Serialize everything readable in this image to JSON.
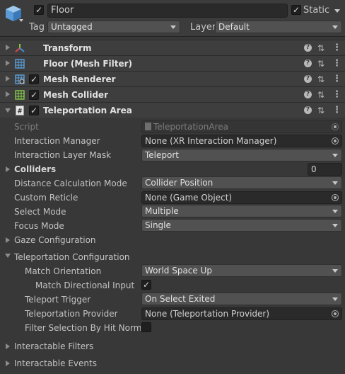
{
  "header": {
    "object_name": "Floor",
    "static_label": "Static",
    "tag_label": "Tag",
    "tag_value": "Untagged",
    "layer_label": "Layer",
    "layer_value": "Default",
    "active_checked": true,
    "static_checked": true
  },
  "components": [
    {
      "name": "Transform",
      "icon": "transform-icon",
      "has_checkbox": false
    },
    {
      "name": "Floor (Mesh Filter)",
      "icon": "mesh-filter-icon",
      "has_checkbox": false
    },
    {
      "name": "Mesh Renderer",
      "icon": "mesh-renderer-icon",
      "has_checkbox": true
    },
    {
      "name": "Mesh Collider",
      "icon": "mesh-collider-icon",
      "has_checkbox": true
    },
    {
      "name": "Teleportation Area",
      "icon": "script-icon",
      "has_checkbox": true
    }
  ],
  "help_glyph": "?",
  "presets_glyph": "⇅",
  "more_glyph": "⋮",
  "check_glyph": "✓",
  "properties": {
    "script_label": "Script",
    "script_value": "TeleportationArea",
    "interaction_manager_label": "Interaction Manager",
    "interaction_manager_value": "None (XR Interaction Manager)",
    "interaction_layer_mask_label": "Interaction Layer Mask",
    "interaction_layer_mask_value": "Teleport",
    "colliders_label": "Colliders",
    "colliders_value": "0",
    "distance_calc_label": "Distance Calculation Mode",
    "distance_calc_value": "Collider Position",
    "custom_reticle_label": "Custom Reticle",
    "custom_reticle_value": "None (Game Object)",
    "select_mode_label": "Select Mode",
    "select_mode_value": "Multiple",
    "focus_mode_label": "Focus Mode",
    "focus_mode_value": "Single",
    "gaze_config_label": "Gaze Configuration",
    "teleport_config_label": "Teleportation Configuration",
    "match_orientation_label": "Match Orientation",
    "match_orientation_value": "World Space Up",
    "match_directional_label": "Match Directional Input",
    "match_directional_checked": true,
    "teleport_trigger_label": "Teleport Trigger",
    "teleport_trigger_value": "On Select Exited",
    "teleport_provider_label": "Teleportation Provider",
    "teleport_provider_value": "None (Teleportation Provider)",
    "filter_selection_label": "Filter Selection By Hit Normal",
    "filter_selection_checked": false,
    "interactable_filters_label": "Interactable Filters",
    "interactable_events_label": "Interactable Events"
  }
}
